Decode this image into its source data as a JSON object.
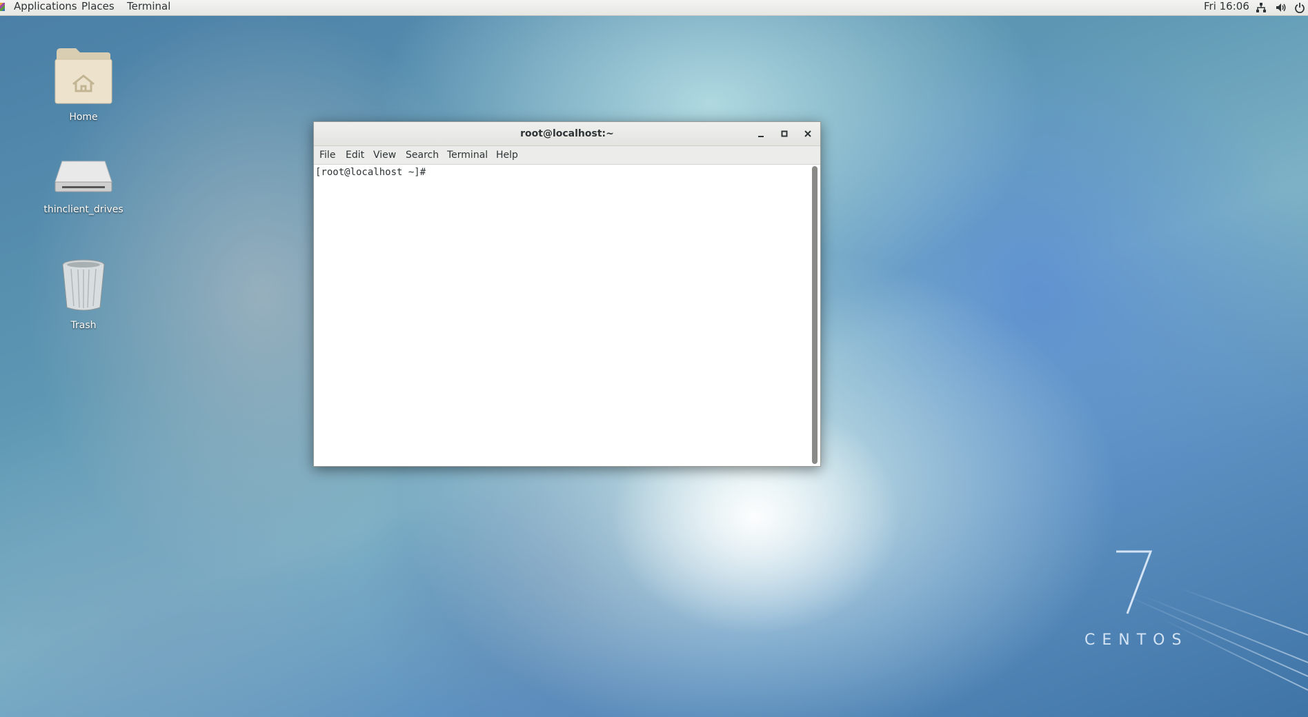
{
  "topbar": {
    "applications": "Applications",
    "places": "Places",
    "terminal": "Terminal",
    "clock": "Fri 16:06",
    "icons": [
      "network-icon",
      "volume-icon",
      "power-icon"
    ]
  },
  "desktop": {
    "icons": [
      {
        "label": "Home",
        "icon": "home-folder-icon"
      },
      {
        "label": "thinclient_drives",
        "icon": "drive-icon"
      },
      {
        "label": "Trash",
        "icon": "trash-icon"
      }
    ],
    "logo_number": "7",
    "logo_text": "CENTOS"
  },
  "terminal_window": {
    "title": "root@localhost:~",
    "menu": [
      "File",
      "Edit",
      "View",
      "Search",
      "Terminal",
      "Help"
    ],
    "prompt": "[root@localhost ~]#"
  }
}
